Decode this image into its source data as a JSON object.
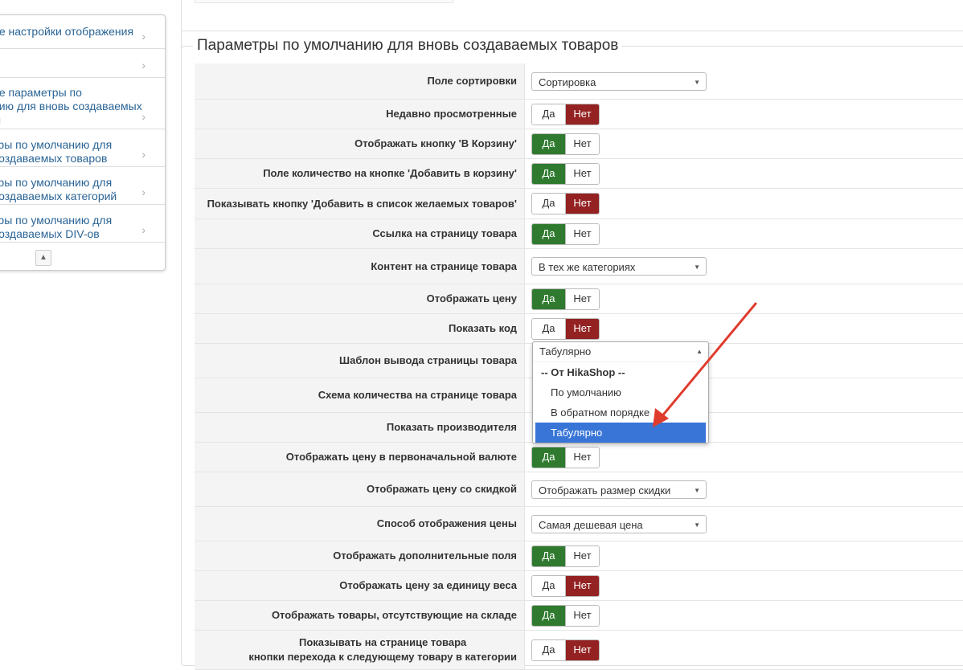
{
  "sidebar": {
    "items": [
      {
        "label": "ие настройки отображения",
        "lines": [
          "ие настройки отображения"
        ]
      },
      {
        "label": "",
        "lines": [
          ""
        ]
      },
      {
        "label": "ие параметры по нию для вновь создаваемых",
        "lines": [
          "ие параметры по",
          "нию для вновь создаваемых",
          "ы"
        ]
      },
      {
        "label": "тры по умолчанию для создаваемых товаров",
        "lines": [
          "тры по умолчанию для",
          "создаваемых товаров"
        ]
      },
      {
        "label": "тры по умолчанию для создаваемых категорий",
        "lines": [
          "тры по умолчанию для",
          "создаваемых категорий"
        ]
      },
      {
        "label": "тры по умолчанию для создаваемых DIV-ов",
        "lines": [
          "тры по умолчанию для",
          "создаваемых DIV-ов"
        ]
      }
    ],
    "chevron": "›",
    "up_icon": "▲"
  },
  "section": {
    "title": "Параметры по умолчанию для вновь создаваемых товаров"
  },
  "rows": [
    {
      "label": "Поле сортировки",
      "type": "select",
      "value": "Сортировка"
    },
    {
      "label": "Недавно просмотренные",
      "type": "toggle",
      "yes": "Да",
      "no": "Нет",
      "state": "no"
    },
    {
      "label": "Отображать кнопку 'В Корзину'",
      "type": "toggle",
      "yes": "Да",
      "no": "Нет",
      "state": "yes"
    },
    {
      "label": "Поле количество на кнопке 'Добавить в корзину'",
      "type": "toggle",
      "yes": "Да",
      "no": "Нет",
      "state": "yes"
    },
    {
      "label": "Показывать кнопку 'Добавить в список желаемых товаров'",
      "type": "toggle",
      "yes": "Да",
      "no": "Нет",
      "state": "no"
    },
    {
      "label": "Ссылка на страницу товара",
      "type": "toggle",
      "yes": "Да",
      "no": "Нет",
      "state": "yes"
    },
    {
      "label": "Контент на странице товара",
      "type": "select",
      "value": "В тех же категориях"
    },
    {
      "label": "Отображать цену",
      "type": "toggle",
      "yes": "Да",
      "no": "Нет",
      "state": "yes"
    },
    {
      "label": "Показать код",
      "type": "toggle",
      "yes": "Да",
      "no": "Нет",
      "state": "no"
    },
    {
      "label": "Шаблон вывода страницы товара",
      "type": "none"
    },
    {
      "label": "Схема количества на странице товара",
      "type": "none"
    },
    {
      "label": "Показать производителя",
      "type": "none"
    },
    {
      "label": "Отображать цену в первоначальной валюте",
      "type": "toggle",
      "yes": "Да",
      "no": "Нет",
      "state": "yes"
    },
    {
      "label": "Отображать цену со скидкой",
      "type": "select",
      "value": "Отображать размер скидки"
    },
    {
      "label": "Способ отображения цены",
      "type": "select",
      "value": "Самая дешевая цена"
    },
    {
      "label": "Отображать дополнительные поля",
      "type": "toggle",
      "yes": "Да",
      "no": "Нет",
      "state": "yes"
    },
    {
      "label": "Отображать цену за единицу веса",
      "type": "toggle",
      "yes": "Да",
      "no": "Нет",
      "state": "no"
    },
    {
      "label": "Отображать товары, отсутствующие на складе",
      "type": "toggle",
      "yes": "Да",
      "no": "Нет",
      "state": "yes"
    },
    {
      "label": "Показывать на странице товара кнопки перехода к следующему товару в категории",
      "lines": [
        "Показывать на странице товара",
        "кнопки перехода к следующему товару в категории"
      ],
      "type": "toggle",
      "yes": "Да",
      "no": "Нет",
      "state": "no"
    }
  ],
  "dropdown": {
    "current": "Табулярно",
    "group": "-- От HikaShop --",
    "options": [
      "По умолчанию",
      "В обратном порядке",
      "Табулярно"
    ],
    "selected": "Табулярно"
  },
  "colors": {
    "yes": "#2f7a2f",
    "no": "#942222",
    "highlight": "#3875d7",
    "arrow": "#e03c2e",
    "link": "#2a6496"
  }
}
